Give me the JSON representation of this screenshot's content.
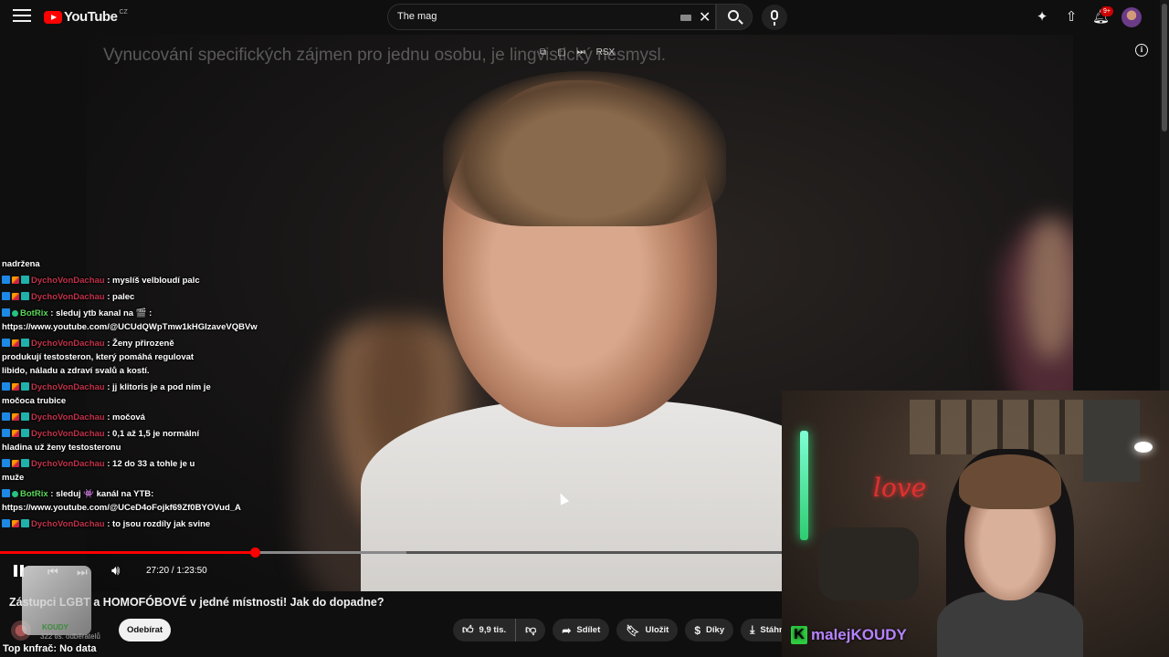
{
  "header": {
    "logo_text": "YouTube",
    "logo_country": "CZ",
    "search_value": "The mag",
    "notification_badge": "9+"
  },
  "video": {
    "subtitle": "Vynucování specifických zájmen pro jednu osobu, je lingvistický nesmysl.",
    "overlay_hd": "RSX",
    "time_current": "27:20",
    "time_total": "1:23:50",
    "time_display": "27:20 / 1:23:50",
    "progress_fraction": 0.326,
    "buffer_fraction": 0.52
  },
  "chat": [
    {
      "badges": [],
      "user": "",
      "user_color": "white",
      "text": "nadržena"
    },
    {
      "badges": [
        "blue",
        "sword",
        "cyan"
      ],
      "user": "DychoVonDachau",
      "user_color": "red",
      "text": ": myslíš velbloudí palc"
    },
    {
      "badges": [
        "blue",
        "sword",
        "cyan"
      ],
      "user": "DychoVonDachau",
      "user_color": "red",
      "text": ": palec"
    },
    {
      "badges": [
        "blue",
        "green"
      ],
      "user": "BotRix",
      "user_color": "green",
      "text": ": sleduj ytb kanal na 🎬 : https://www.youtube.com/@UCUdQWpTmw1kHGIzaveVQBVw"
    },
    {
      "badges": [
        "blue",
        "sword",
        "cyan"
      ],
      "user": "DychoVonDachau",
      "user_color": "red",
      "text": ": Ženy přirozeně produkují testosteron, který pomáhá regulovat libido, náladu a zdraví svalů a kostí."
    },
    {
      "badges": [
        "blue",
        "sword",
        "cyan"
      ],
      "user": "DychoVonDachau",
      "user_color": "red",
      "text": ": jj klitoris je a pod ním je močoca trubice"
    },
    {
      "badges": [
        "blue",
        "sword",
        "cyan"
      ],
      "user": "DychoVonDachau",
      "user_color": "red",
      "text": ": močová"
    },
    {
      "badges": [
        "blue",
        "sword",
        "cyan"
      ],
      "user": "DychoVonDachau",
      "user_color": "red",
      "text": ": 0,1 až 1,5 je normální hladina už ženy testosteronu"
    },
    {
      "badges": [
        "blue",
        "sword",
        "cyan"
      ],
      "user": "DychoVonDachau",
      "user_color": "red",
      "text": ": 12 do 33 a tohle je u muže"
    },
    {
      "badges": [
        "blue",
        "green"
      ],
      "user": "BotRix",
      "user_color": "green",
      "text": ": sleduj 👾 kanál na YTB: https://www.youtube.com/@UCeD4oFojkf69Zf0BYOVud_A"
    },
    {
      "badges": [
        "blue",
        "sword",
        "cyan"
      ],
      "user": "DychoVonDachau",
      "user_color": "red",
      "text": ": to jsou rozdíly jak svine"
    }
  ],
  "meta": {
    "title": "Zástupci LGBT a HOMOFÓBOVÉ v jedné místnosti! Jak do dopadne?",
    "subs": "322 tis. odběratelů",
    "subscribe_label": "Odebírat",
    "sticker_text": "KOUDY",
    "top_line": "Top knfrač: No data"
  },
  "actions": {
    "like_count": "9,9 tis.",
    "share_label": "Sdílet",
    "save_label": "Uložit",
    "thanks_label": "Díky",
    "download_label": "Stáhnou"
  },
  "webcam": {
    "brand": "malejKOUDY",
    "brand_k": "K",
    "sign_text": "love"
  },
  "icons": {
    "menu": "hamburger-icon",
    "search": "search-icon",
    "mic": "mic-icon",
    "create": "create-icon",
    "upload": "upload-icon",
    "bell": "bell-icon",
    "info": "info-icon"
  },
  "colors": {
    "accent": "#ff0000",
    "chat_user_red": "#c0324a",
    "chat_user_green": "#5bd75b",
    "brand_purple": "#b583ff",
    "brand_green": "#2ecc40"
  }
}
